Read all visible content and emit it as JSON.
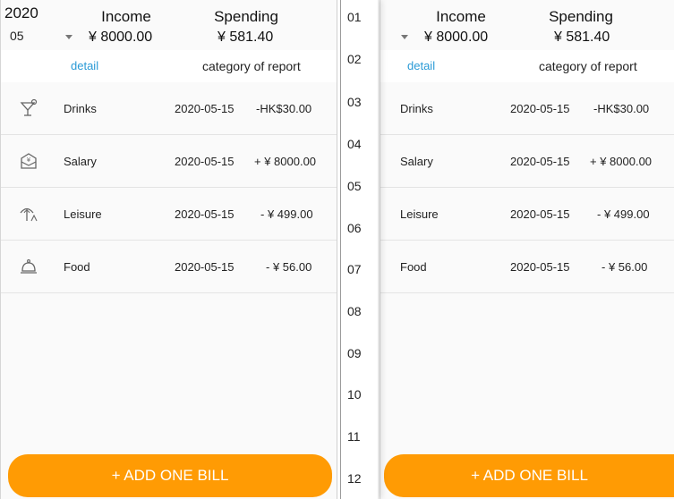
{
  "left": {
    "year": "2020",
    "month": "05",
    "income_label": "Income",
    "income_value": "¥ 8000.00",
    "spending_label": "Spending",
    "spending_value": "¥ 581.40",
    "tab_detail": "detail",
    "tab_report": "category of report",
    "bills": [
      {
        "category": "Drinks",
        "date": "2020-05-15",
        "amount": "-HK$30.00",
        "icon": "cocktail-glass-icon"
      },
      {
        "category": "Salary",
        "date": "2020-05-15",
        "amount": "+ ¥ 8000.00",
        "icon": "salary-envelope-icon"
      },
      {
        "category": "Leisure",
        "date": "2020-05-15",
        "amount": "- ¥ 499.00",
        "icon": "beach-umbrella-icon"
      },
      {
        "category": "Food",
        "date": "2020-05-15",
        "amount": "- ¥ 56.00",
        "icon": "food-cloche-icon"
      }
    ],
    "add_button": "+ ADD ONE BILL"
  },
  "month_picker": {
    "months": [
      "01",
      "02",
      "03",
      "04",
      "05",
      "06",
      "07",
      "08",
      "09",
      "10",
      "11",
      "12"
    ]
  },
  "right": {
    "income_label": "Income",
    "income_value": "¥ 8000.00",
    "spending_label": "Spending",
    "spending_value": "¥ 581.40",
    "tab_detail": "detail",
    "tab_report": "category of report",
    "bills": [
      {
        "category": "Drinks",
        "date": "2020-05-15",
        "amount": "-HK$30.00"
      },
      {
        "category": "Salary",
        "date": "2020-05-15",
        "amount": "+ ¥ 8000.00"
      },
      {
        "category": "Leisure",
        "date": "2020-05-15",
        "amount": "- ¥ 499.00"
      },
      {
        "category": "Food",
        "date": "2020-05-15",
        "amount": "- ¥ 56.00"
      }
    ],
    "add_button": "+ ADD ONE BILL"
  },
  "colors": {
    "accent": "#ff9b04",
    "link": "#2a9ad6"
  }
}
